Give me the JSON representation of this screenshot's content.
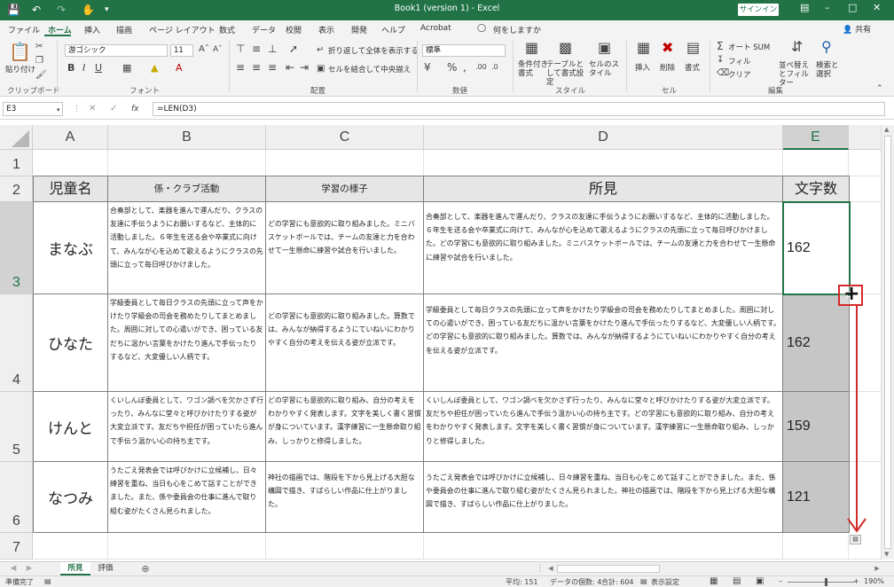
{
  "titlebar": {
    "title": "Book1 (version 1) - Excel",
    "signin": "サインイン",
    "save_icon": "save-icon",
    "undo_icon": "undo-icon",
    "redo_icon": "redo-icon",
    "touch_icon": "touch-mode-icon"
  },
  "tabs": [
    "ファイル",
    "ホーム",
    "挿入",
    "描画",
    "ページ レイアウト",
    "数式",
    "データ",
    "校閲",
    "表示",
    "開発",
    "ヘルプ",
    "Acrobat"
  ],
  "tell_me": "何をしますか",
  "share": "共有",
  "ribbon": {
    "clipboard": {
      "label": "クリップボード",
      "paste": "貼り付け"
    },
    "font": {
      "label": "フォント",
      "family": "游ゴシック",
      "size": "11"
    },
    "alignment": {
      "label": "配置",
      "wrap": "折り返して全体を表示する",
      "merge": "セルを結合して中央揃え"
    },
    "number": {
      "label": "数値",
      "format": "標準"
    },
    "styles": {
      "label": "スタイル",
      "conditional": "条件付き書式",
      "as_table": "テーブルとして書式設定",
      "cell_styles": "セルのスタイル"
    },
    "cells": {
      "label": "セル",
      "insert": "挿入",
      "delete": "削除",
      "format": "書式"
    },
    "editing": {
      "label": "編集",
      "autosum": "オート SUM",
      "fill": "フィル",
      "clear": "クリア",
      "sort": "並べ替えとフィルター",
      "find": "検索と選択"
    }
  },
  "formula_bar": {
    "namebox": "E3",
    "formula": "=LEN(D3)",
    "fx": "fx"
  },
  "columns": [
    "A",
    "B",
    "C",
    "D",
    "E"
  ],
  "rows": [
    "1",
    "2",
    "3",
    "4",
    "5",
    "6",
    "7"
  ],
  "headers": {
    "a": "児童名",
    "b": "係・クラブ活動",
    "c": "学習の様子",
    "d": "所見",
    "e": "文字数"
  },
  "records": [
    {
      "name": "まなぶ",
      "club": "合奏部として、楽器を進んで運んだり、クラスの友達に手伝うようにお願いするなど、主体的に活動しました。６年生を送る会や卒業式に向けて、みんなが心を込めて歌えるようにクラスの先頭に立って毎日呼びかけました。",
      "study": "どの学習にも意欲的に取り組みました。ミニバスケットボールでは、チームの友達と力を合わせて一生懸命に練習や試合を行いました。",
      "remark": "合奏部として、楽器を進んで運んだり、クラスの友達に手伝うようにお願いするなど、主体的に活動しました。６年生を送る会や卒業式に向けて、みんなが心を込めて歌えるようにクラスの先頭に立って毎日呼びかけました。どの学習にも意欲的に取り組みました。ミニバスケットボールでは、チームの友達と力を合わせて一生懸命に練習や試合を行いました。",
      "count": "162"
    },
    {
      "name": "ひなた",
      "club": "学級委員として毎日クラスの先頭に立って声をかけたり学級会の司会を務めたりしてまとめました。周囲に対しての心遣いができ、困っている友だちに温かい言葉をかけたり進んで手伝ったりするなど、大変優しい人柄です。",
      "study": "どの学習にも意欲的に取り組みました。算数では、みんなが納得するようにていねいにわかりやすく自分の考えを伝える姿が立派です。",
      "remark": "学級委員として毎日クラスの先頭に立って声をかけたり学級会の司会を務めたりしてまとめました。周囲に対しての心遣いができ、困っている友だちに温かい言葉をかけたり進んで手伝ったりするなど、大変優しい人柄です。どの学習にも意欲的に取り組みました。算数では、みんなが納得するようにていねいにわかりやすく自分の考えを伝える姿が立派です。",
      "count": "162"
    },
    {
      "name": "けんと",
      "club": "くいしんぼ委員として、ワゴン調べを欠かさず行ったり、みんなに堂々と呼びかけたりする姿が大変立派です。友だちや担任が困っていたら進んで手伝う温かい心の持ち主です。",
      "study": "どの学習にも意欲的に取り組み、自分の考えをわかりやすく発表します。文字を美しく書く習慣が身についています。漢字練習に一生懸命取り組み、しっかりと修得しました。",
      "remark": "くいしんぼ委員として、ワゴン調べを欠かさず行ったり、みんなに堂々と呼びかけたりする姿が大変立派です。友だちや担任が困っていたら進んで手伝う温かい心の持ち主です。どの学習にも意欲的に取り組み、自分の考えをわかりやすく発表します。文字を美しく書く習慣が身についています。漢字練習に一生懸命取り組み、しっかりと修得しました。",
      "count": "159"
    },
    {
      "name": "なつみ",
      "club": "うたごえ発表会では呼びかけに立候補し、日々練習を重ね、当日も心をこめて話すことができました。また、係や委員会の仕事に進んで取り組む姿がたくさん見られました。",
      "study": "神社の描画では、階段を下から見上げる大胆な構図で描き、すばらしい作品に仕上がりました。",
      "remark": "うたごえ発表会では呼びかけに立候補し、日々練習を重ね、当日も心をこめて話すことができました。また、係や委員会の仕事に進んで取り組む姿がたくさん見られました。神社の描画では、階段を下から見上げる大胆な構図で描き、すばらしい作品に仕上がりました。",
      "count": "121"
    }
  ],
  "sheets": [
    "所見",
    "評価"
  ],
  "status": {
    "ready": "準備完了",
    "average": "平均: 151",
    "count": "データの個数: 4",
    "sum": "合計: 604",
    "display": "表示設定",
    "zoom": "190%"
  },
  "colors": {
    "excel_green": "#217346",
    "annotation_red": "#d42a2a",
    "fill_gray": "#c6c6c6"
  }
}
